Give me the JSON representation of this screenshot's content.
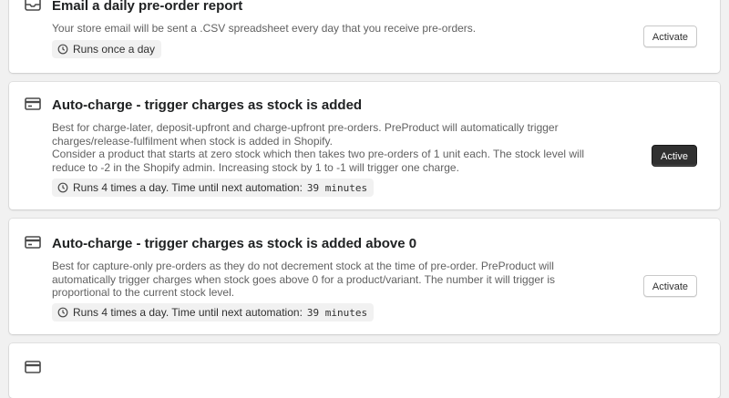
{
  "cards": [
    {
      "icon": "inbox-tray-icon",
      "title": "Email a daily pre-order report",
      "description": [
        "Your store email will be sent a .CSV spreadsheet every day that you receive pre-orders."
      ],
      "schedule": {
        "text": "Runs once a day"
      },
      "button": {
        "label": "Activate",
        "state": "inactive"
      }
    },
    {
      "icon": "credit-card-icon",
      "title": "Auto-charge - trigger charges as stock is added",
      "description": [
        "Best for charge-later, deposit-upfront and charge-upfront pre-orders. PreProduct will automatically trigger charges/release-fulfilment when stock is added in Shopify.",
        "Consider a product that starts at zero stock which then takes two pre-orders of 1 unit each. The stock level will reduce to -2 in the Shopify admin. Increasing stock by 1 to -1 will trigger one charge."
      ],
      "schedule": {
        "text": "Runs 4 times a day. Time until next automation:",
        "countdown": "39 minutes"
      },
      "button": {
        "label": "Active",
        "state": "active"
      }
    },
    {
      "icon": "credit-card-icon",
      "title": "Auto-charge - trigger charges as stock is added above 0",
      "description": [
        "Best for capture-only pre-orders as they do not decrement stock at the time of pre-order. PreProduct will automatically trigger charges when stock goes above 0 for a product/variant. The number it will trigger is proportional to the current stock level."
      ],
      "schedule": {
        "text": "Runs 4 times a day. Time until next automation:",
        "countdown": "39 minutes"
      },
      "button": {
        "label": "Activate",
        "state": "inactive"
      }
    },
    {
      "icon": "credit-card-icon"
    }
  ],
  "colors": {
    "primary_button": "#303030",
    "page_background": "#f1f1f1",
    "badge_background": "#f1f1f1"
  }
}
